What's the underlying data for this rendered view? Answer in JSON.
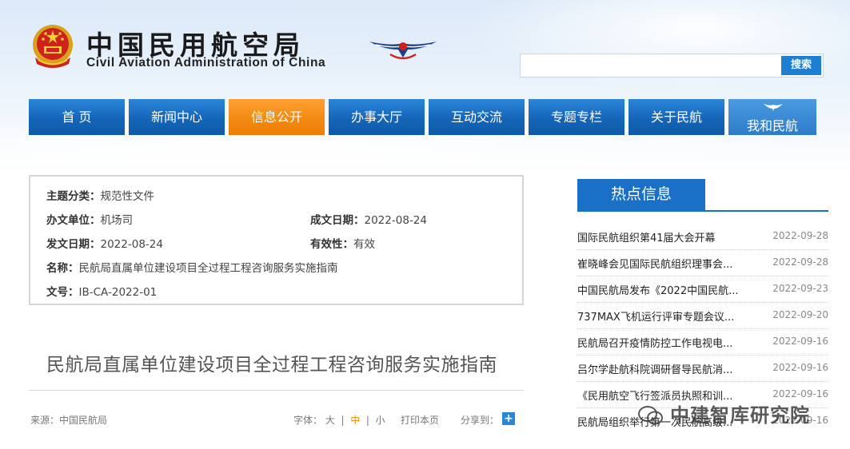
{
  "header": {
    "title_cn": "中国民用航空局",
    "title_en": "Civil Aviation Administration of China"
  },
  "search": {
    "placeholder": "",
    "button": "搜索"
  },
  "nav": {
    "items": [
      "首 页",
      "新闻中心",
      "信息公开",
      "办事大厅",
      "互动交流",
      "专题专栏",
      "关于民航",
      "我和民航"
    ],
    "active_index": 2
  },
  "info": {
    "category_key": "主题分类：",
    "category_val": "规范性文件",
    "dept_key": "办文单位：",
    "dept_val": "机场司",
    "created_key": "成文日期：",
    "created_val": "2022-08-24",
    "issued_key": "发文日期：",
    "issued_val": "2022-08-24",
    "validity_key": "有效性：",
    "validity_val": "有效",
    "name_key": "名称：",
    "name_val": "民航局直属单位建设项目全过程工程咨询服务实施指南",
    "docno_key": "文号：",
    "docno_val": "IB-CA-2022-01"
  },
  "article": {
    "title": "民航局直属单位建设项目全过程工程咨询服务实施指南",
    "source": "来源：中国民航局",
    "font_label": "字体：",
    "font_large": "大",
    "font_mid": "中",
    "font_small": "小",
    "sep": "|",
    "print": "打印本页",
    "share": "分享到："
  },
  "hot": {
    "title": "热点信息",
    "items": [
      {
        "title": "国际民航组织第41届大会开幕",
        "date": "2022-09-28"
      },
      {
        "title": "崔晓峰会见国际民航组织理事会...",
        "date": "2022-09-28"
      },
      {
        "title": "中国民航局发布《2022中国民航...",
        "date": "2022-09-23"
      },
      {
        "title": "737MAX飞机运行评审专题会议...",
        "date": "2022-09-20"
      },
      {
        "title": "民航局召开疫情防控工作电视电...",
        "date": "2022-09-16"
      },
      {
        "title": "吕尔学赴航科院调研督导民航消...",
        "date": "2022-09-16"
      },
      {
        "title": "《民用航空飞行签派员执照和训...",
        "date": "2022-09-16"
      },
      {
        "title": "民航局组织举行第一次民航高级...",
        "date": "2022-09-16"
      }
    ]
  },
  "watermark": "中建智库研究院",
  "colors": {
    "nav_blue": "#1565b8",
    "nav_active": "#f28a12",
    "accent": "#1a6fc6"
  }
}
